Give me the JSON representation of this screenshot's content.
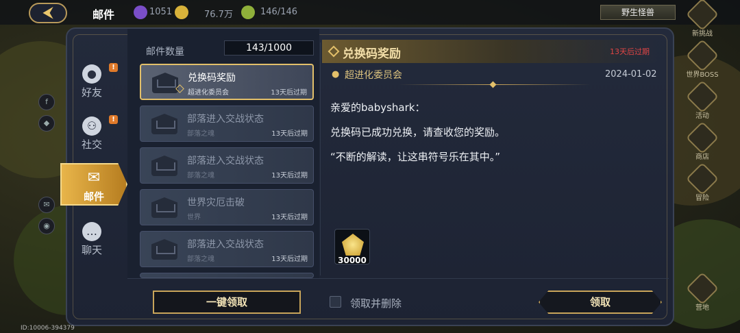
{
  "topbar": {
    "title": "邮件",
    "back_icon": "back-arrow-icon",
    "resources": [
      {
        "icon": "gem-icon",
        "value": "1051",
        "color": "#7a4ec8"
      },
      {
        "icon": "gold-icon",
        "value": "76.7万",
        "color": "#d8b23a"
      },
      {
        "icon": "food-icon",
        "value": "146/146",
        "color": "#8fb03a"
      }
    ],
    "wild_button": "野生怪兽"
  },
  "right_strip": [
    {
      "label": "新挑战",
      "icon": "challenge-icon"
    },
    {
      "label": "世界BOSS",
      "icon": "boss-icon"
    },
    {
      "label": "活动",
      "icon": "event-icon"
    },
    {
      "label": "商店",
      "icon": "shop-icon"
    },
    {
      "label": "冒险",
      "icon": "adventure-icon"
    },
    {
      "label": "营地",
      "icon": "camp-icon"
    }
  ],
  "tabs": [
    {
      "label": "好友",
      "icon": "friend-icon",
      "badge": "!"
    },
    {
      "label": "社交",
      "icon": "social-icon",
      "badge": "!"
    },
    {
      "label": "邮件",
      "icon": "mail-icon",
      "badge": ""
    },
    {
      "label": "聊天",
      "icon": "chat-icon",
      "badge": ""
    }
  ],
  "list": {
    "count_label": "邮件数量",
    "count_value": "143/1000",
    "items": [
      {
        "title": "兑换码奖励",
        "sender": "超进化委员会",
        "expire": "13天后过期"
      },
      {
        "title": "部落进入交战状态",
        "sender": "部落之魂",
        "expire": "13天后过期"
      },
      {
        "title": "部落进入交战状态",
        "sender": "部落之魂",
        "expire": "13天后过期"
      },
      {
        "title": "世界灾厄击破",
        "sender": "世界",
        "expire": "13天后过期"
      },
      {
        "title": "部落进入交战状态",
        "sender": "部落之魂",
        "expire": "13天后过期"
      }
    ],
    "one_key_button": "一键领取"
  },
  "detail": {
    "title": "兑换码奖励",
    "expire": "13天后过期",
    "sender": "超进化委员会",
    "date": "2024-01-02",
    "lines": [
      "亲爱的babyshark：",
      "兑换码已成功兑换，请查收您的奖励。",
      "“不断的解读，让这串符号乐在其中。”"
    ],
    "reward_qty": "30000",
    "reward_icon": "gold-coin-icon",
    "delete_label": "领取并删除",
    "claim_button": "领取"
  },
  "footer_id": "ID:10006-394379",
  "colors": {
    "accent": "#e3c06a",
    "expire_red": "#e04545"
  }
}
